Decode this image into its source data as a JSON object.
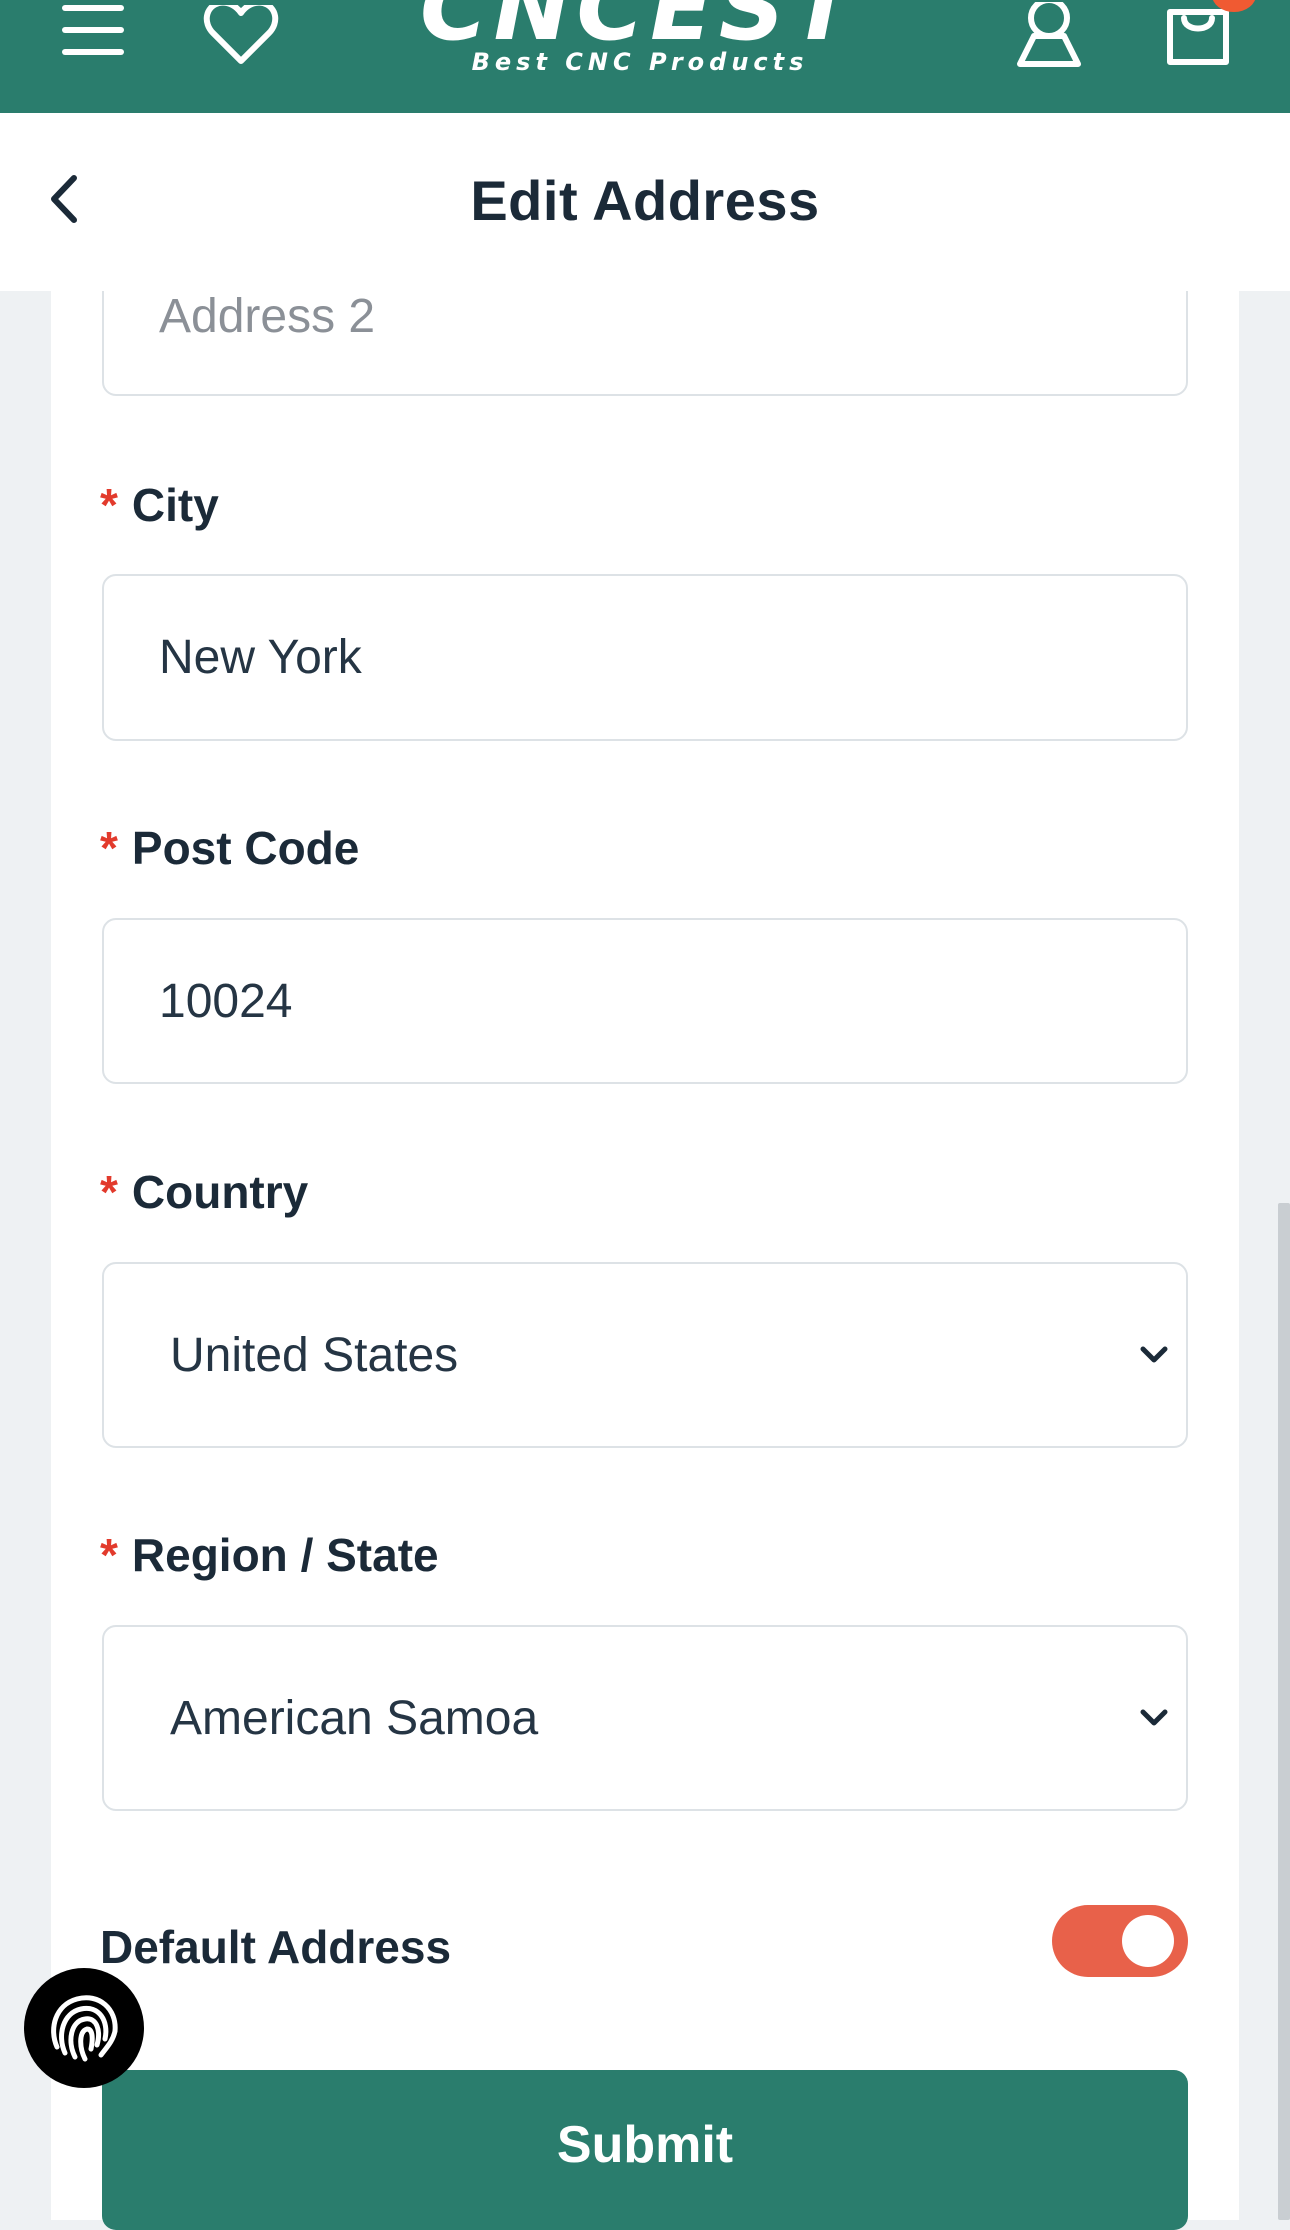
{
  "brand": {
    "logo_word": "CNCEST",
    "tagline": "Best CNC Products",
    "colors": {
      "primary": "#2a7d6d",
      "accent": "#f05a32",
      "required": "#e23a2c",
      "toggle_on": "#e8614a"
    }
  },
  "topbar": {
    "icons": [
      "menu-icon",
      "heart-icon",
      "user-icon",
      "cart-icon"
    ]
  },
  "header": {
    "title": "Edit Address",
    "back_icon": "chevron-left-icon"
  },
  "form": {
    "address2": {
      "placeholder": "Address 2",
      "value": ""
    },
    "city": {
      "label": "City",
      "required_mark": "*",
      "value": "New York"
    },
    "post_code": {
      "label": "Post Code",
      "required_mark": "*",
      "value": "10024"
    },
    "country": {
      "label": "Country",
      "required_mark": "*",
      "selected": "United States"
    },
    "region": {
      "label": "Region / State",
      "required_mark": "*",
      "selected": "American Samoa"
    },
    "default_address": {
      "label": "Default Address",
      "enabled": true
    },
    "submit_label": "Submit"
  },
  "floating": {
    "icon": "fingerprint-icon"
  }
}
